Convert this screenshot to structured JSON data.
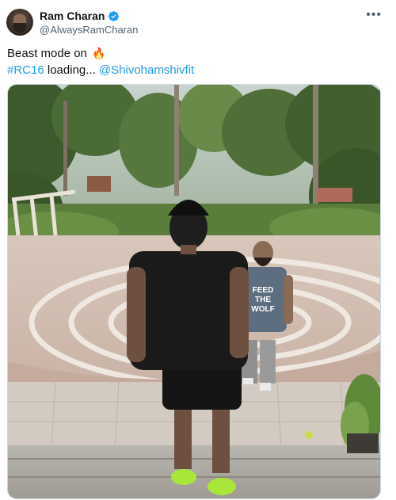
{
  "author": {
    "display_name": "Ram Charan",
    "handle": "@AlwaysRamCharan",
    "verified": true
  },
  "tweet": {
    "line1_text": "Beast mode on",
    "line1_emoji": "🔥",
    "hashtag": "#RC16",
    "middle_text": " loading... ",
    "mention": "@Shivohamshivfit"
  },
  "media": {
    "shirt_text_1": "FEED",
    "shirt_text_2": "THE",
    "shirt_text_3": "WOLF"
  },
  "icons": {
    "more": "more-horizontal-icon",
    "verified": "verified-badge-icon"
  },
  "colors": {
    "link": "#1d9bf0",
    "verified": "#1d9bf0",
    "secondary_text": "#536471",
    "shoe_green": "#a8e63a"
  }
}
